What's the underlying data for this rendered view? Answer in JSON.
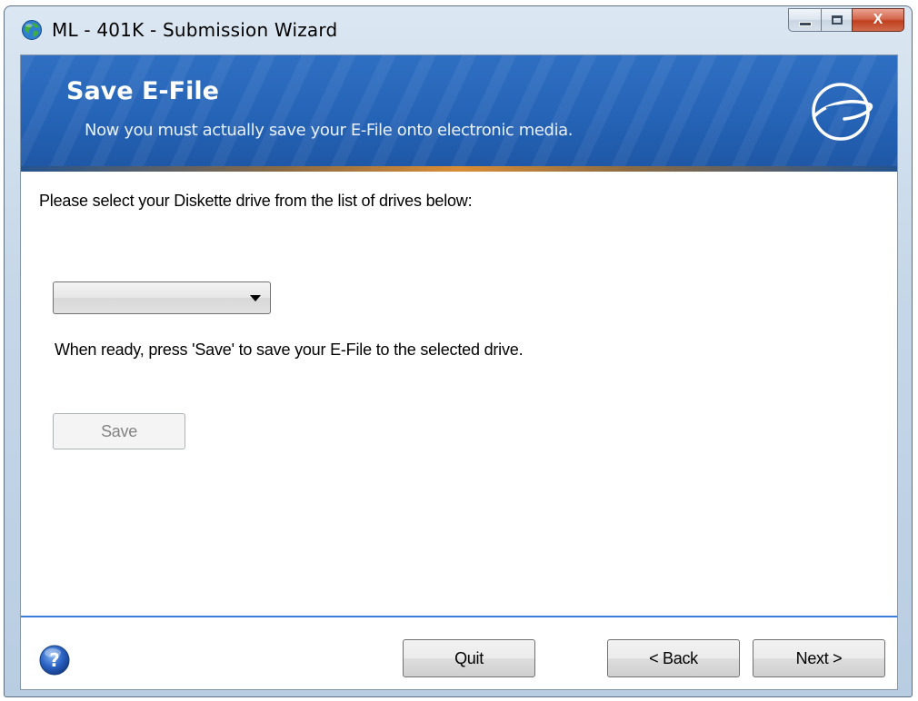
{
  "window": {
    "title": "ML - 401K - Submission Wizard",
    "app_icon": "globe-icon",
    "caption_buttons": {
      "minimize": "minimize-icon",
      "maximize": "maximize-icon",
      "close_label": "X"
    }
  },
  "banner": {
    "title": "Save E-File",
    "subtitle": "Now you must actually save your E-File onto electronic media.",
    "logo_icon": "e-logo-icon",
    "color": "#2563b6"
  },
  "content": {
    "instruction": "Please select your Diskette drive from the list of drives below:",
    "drive_select": {
      "selected_value": ""
    },
    "ready_text": "When ready, press 'Save' to save your E-File to the selected drive.",
    "save_label": "Save"
  },
  "footer": {
    "help_icon": "help-icon",
    "quit_label": "Quit",
    "back_label": "< Back",
    "next_label": "Next >",
    "accent": "#3b7dd8"
  }
}
